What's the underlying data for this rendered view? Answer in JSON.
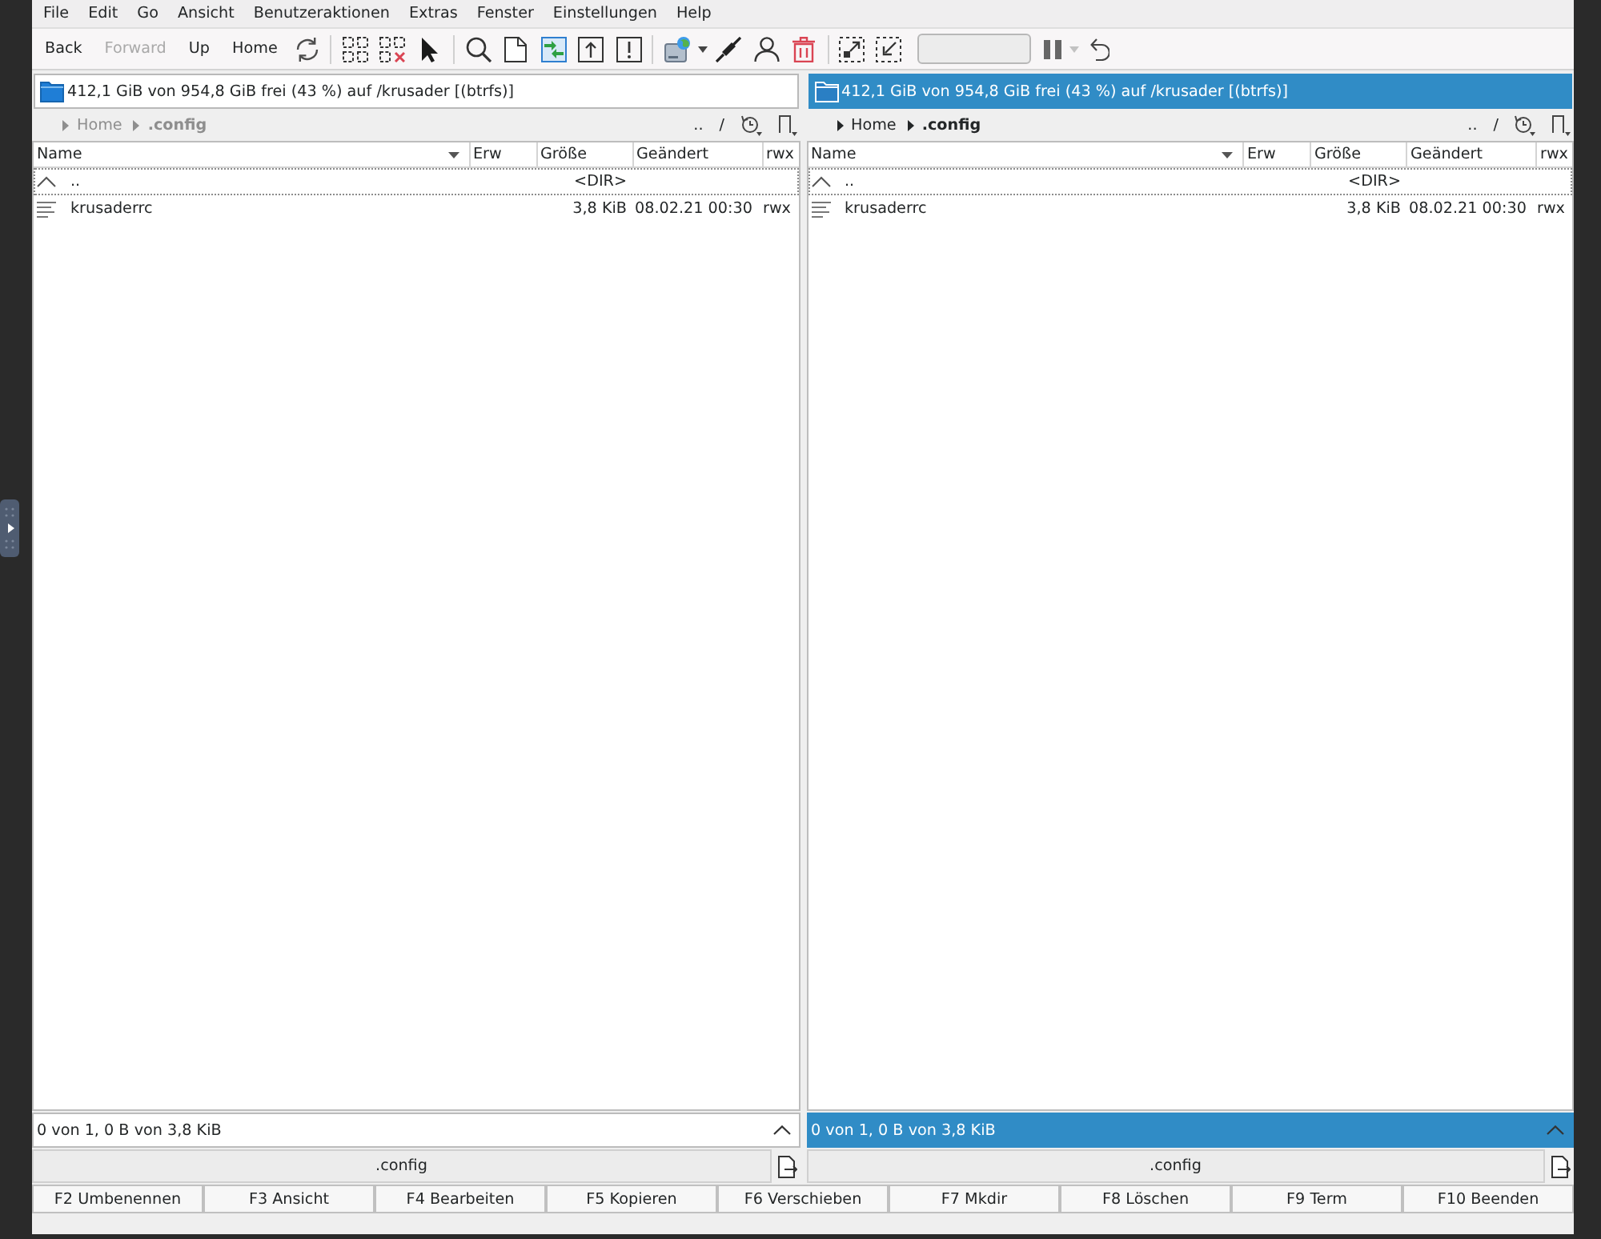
{
  "menu_bar": [
    "File",
    "Edit",
    "Go",
    "Ansicht",
    "Benutzeraktionen",
    "Extras",
    "Fenster",
    "Einstellungen",
    "Help"
  ],
  "toolbar": {
    "nav_buttons": [
      {
        "label": "Back",
        "disabled": false
      },
      {
        "label": "Forward",
        "disabled": true
      },
      {
        "label": "Up",
        "disabled": false
      },
      {
        "label": "Home",
        "disabled": false
      }
    ],
    "pause_dropdown": {
      "disabled": true
    }
  },
  "panels": [
    {
      "active": false,
      "disk_info": "412,1 GiB von 954,8 GiB frei (43 %) auf /krusader [(btrfs)]",
      "breadcrumb": [
        "Home",
        ".config"
      ],
      "up_button": "..",
      "root_button": "/",
      "columns": [
        {
          "label": "Name",
          "sorted": true
        },
        {
          "label": "Erw",
          "sorted": false
        },
        {
          "label": "Größe",
          "sorted": false
        },
        {
          "label": "Geändert",
          "sorted": false
        },
        {
          "label": "rwx",
          "sorted": false
        }
      ],
      "rows": [
        {
          "kind": "parent",
          "name": "..",
          "size": "<DIR>",
          "current": true
        },
        {
          "kind": "file",
          "name": "krusaderrc",
          "size": "3,8 KiB",
          "modified": "08.02.21 00:30",
          "permissions": "rwx",
          "current": false
        }
      ],
      "status": "0 von 1, 0 B von 3,8 KiB",
      "path": ".config"
    },
    {
      "active": true,
      "disk_info": "412,1 GiB von 954,8 GiB frei (43 %) auf /krusader [(btrfs)]",
      "breadcrumb": [
        "Home",
        ".config"
      ],
      "up_button": "..",
      "root_button": "/",
      "columns": [
        {
          "label": "Name",
          "sorted": true
        },
        {
          "label": "Erw",
          "sorted": false
        },
        {
          "label": "Größe",
          "sorted": false
        },
        {
          "label": "Geändert",
          "sorted": false
        },
        {
          "label": "rwx",
          "sorted": false
        }
      ],
      "rows": [
        {
          "kind": "parent",
          "name": "..",
          "size": "<DIR>",
          "current": true
        },
        {
          "kind": "file",
          "name": "krusaderrc",
          "size": "3,8 KiB",
          "modified": "08.02.21 00:30",
          "permissions": "rwx",
          "current": false
        }
      ],
      "status": "0 von 1, 0 B von 3,8 KiB",
      "path": ".config"
    }
  ],
  "function_keys": [
    "F2 Umbenennen",
    "F3 Ansicht",
    "F4 Bearbeiten",
    "F5 Kopieren",
    "F6 Verschieben",
    "F7 Mkdir",
    "F8 Löschen",
    "F9 Term",
    "F10 Beenden"
  ]
}
